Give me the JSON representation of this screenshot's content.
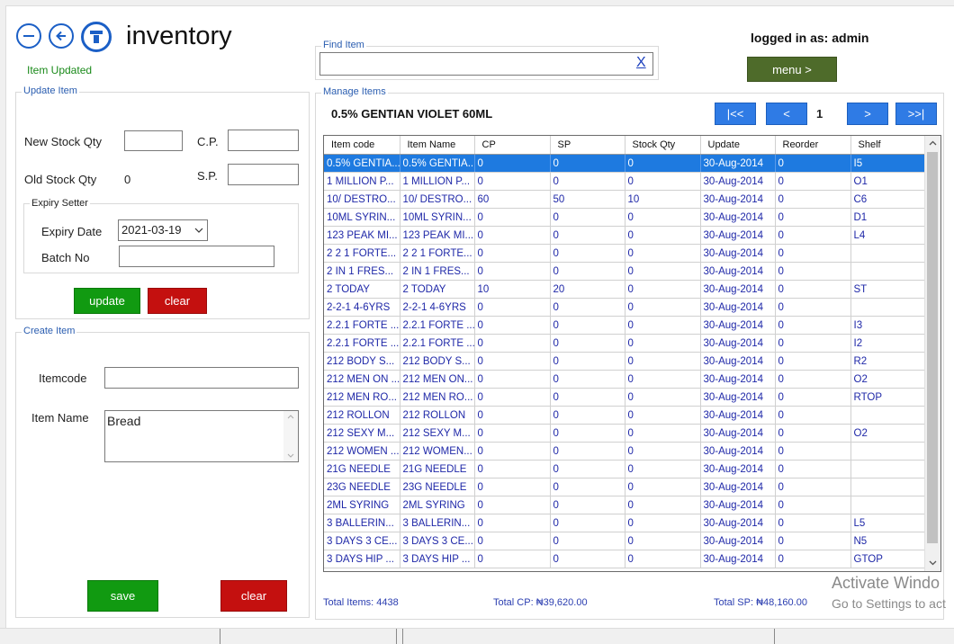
{
  "app": {
    "title": "inventory",
    "status_message": "Item Updated",
    "logged_in_text": "logged in as: admin",
    "menu_label": "menu >"
  },
  "find": {
    "legend": "Find Item",
    "value": "",
    "clear_label": "X"
  },
  "update_item": {
    "legend": "Update Item",
    "new_stock_label": "New Stock Qty",
    "new_stock_value": "",
    "cp_label": "C.P.",
    "cp_value": "",
    "old_stock_label": "Old Stock Qty",
    "old_stock_value": "0",
    "sp_label": "S.P.",
    "sp_value": "",
    "expiry_legend": "Expiry Setter",
    "expiry_label": "Expiry Date",
    "expiry_value": "2021-03-19",
    "batch_label": "Batch No",
    "batch_value": "",
    "update_label": "update",
    "clear_label": "clear"
  },
  "create_item": {
    "legend": "Create Item",
    "itemcode_label": "Itemcode",
    "itemcode_value": "",
    "itemname_label": "Item Name",
    "itemname_value": "Bread",
    "save_label": "save",
    "clear_label": "clear"
  },
  "manage": {
    "legend": "Manage Items",
    "selected_item": "0.5% GENTIAN VIOLET 60ML",
    "pager": {
      "first": "|<<",
      "prev": "<",
      "page": "1",
      "next": ">",
      "last": ">>|"
    },
    "columns": [
      "Item code",
      "Item Name",
      "CP",
      "SP",
      "Stock Qty",
      "Update",
      "Reorder",
      "Shelf"
    ],
    "rows": [
      [
        "0.5% GENTIA...",
        "0.5% GENTIA...",
        "0",
        "0",
        "0",
        "30-Aug-2014",
        "0",
        "I5"
      ],
      [
        "1 MILLION P...",
        "1 MILLION P...",
        "0",
        "0",
        "0",
        "30-Aug-2014",
        "0",
        "O1"
      ],
      [
        "10/ DESTRO...",
        "10/ DESTRO...",
        "60",
        "50",
        "10",
        "30-Aug-2014",
        "0",
        "C6"
      ],
      [
        "10ML SYRIN...",
        "10ML SYRIN...",
        "0",
        "0",
        "0",
        "30-Aug-2014",
        "0",
        "D1"
      ],
      [
        "123 PEAK MI...",
        "123 PEAK MI...",
        "0",
        "0",
        "0",
        "30-Aug-2014",
        "0",
        "L4"
      ],
      [
        "2 2 1 FORTE...",
        "2 2 1 FORTE...",
        "0",
        "0",
        "0",
        "30-Aug-2014",
        "0",
        ""
      ],
      [
        "2 IN 1 FRES...",
        "2 IN 1 FRES...",
        "0",
        "0",
        "0",
        "30-Aug-2014",
        "0",
        ""
      ],
      [
        "2 TODAY",
        "2 TODAY",
        "10",
        "20",
        "0",
        "30-Aug-2014",
        "0",
        "ST"
      ],
      [
        "2-2-1 4-6YRS",
        "2-2-1 4-6YRS",
        "0",
        "0",
        "0",
        "30-Aug-2014",
        "0",
        ""
      ],
      [
        "2.2.1 FORTE ...",
        "2.2.1 FORTE ...",
        "0",
        "0",
        "0",
        "30-Aug-2014",
        "0",
        "I3"
      ],
      [
        "2.2.1 FORTE ...",
        "2.2.1 FORTE ...",
        "0",
        "0",
        "0",
        "30-Aug-2014",
        "0",
        "I2"
      ],
      [
        "212 BODY S...",
        "212 BODY S...",
        "0",
        "0",
        "0",
        "30-Aug-2014",
        "0",
        "R2"
      ],
      [
        "212 MEN ON ...",
        "212 MEN ON...",
        "0",
        "0",
        "0",
        "30-Aug-2014",
        "0",
        "O2"
      ],
      [
        "212 MEN RO...",
        "212 MEN RO...",
        "0",
        "0",
        "0",
        "30-Aug-2014",
        "0",
        "RTOP"
      ],
      [
        "212 ROLLON",
        "212 ROLLON",
        "0",
        "0",
        "0",
        "30-Aug-2014",
        "0",
        ""
      ],
      [
        "212 SEXY M...",
        "212 SEXY M...",
        "0",
        "0",
        "0",
        "30-Aug-2014",
        "0",
        "O2"
      ],
      [
        "212 WOMEN ...",
        "212 WOMEN...",
        "0",
        "0",
        "0",
        "30-Aug-2014",
        "0",
        ""
      ],
      [
        "21G NEEDLE",
        "21G NEEDLE",
        "0",
        "0",
        "0",
        "30-Aug-2014",
        "0",
        ""
      ],
      [
        "23G NEEDLE",
        "23G NEEDLE",
        "0",
        "0",
        "0",
        "30-Aug-2014",
        "0",
        ""
      ],
      [
        "2ML SYRING",
        "2ML SYRING",
        "0",
        "0",
        "0",
        "30-Aug-2014",
        "0",
        ""
      ],
      [
        "3 BALLERIN...",
        "3 BALLERIN...",
        "0",
        "0",
        "0",
        "30-Aug-2014",
        "0",
        "L5"
      ],
      [
        "3 DAYS 3 CE...",
        "3 DAYS 3 CE...",
        "0",
        "0",
        "0",
        "30-Aug-2014",
        "0",
        "N5"
      ],
      [
        "3 DAYS HIP ...",
        "3 DAYS HIP ...",
        "0",
        "0",
        "0",
        "30-Aug-2014",
        "0",
        "GTOP"
      ]
    ],
    "total_items": "Total Items: 4438",
    "total_cp": "Total CP: ₦39,620.00",
    "total_sp": "Total SP: ₦48,160.00"
  },
  "watermark": {
    "line1": "Activate Windo",
    "line2": "Go to Settings to act"
  },
  "colors": {
    "accent_blue": "#2f7be5",
    "selected_row": "#1e7ae0",
    "green_button": "#119a11",
    "red_button": "#c4100f",
    "menu_button": "#4e6b2a",
    "status_text": "#1a8a1a"
  }
}
